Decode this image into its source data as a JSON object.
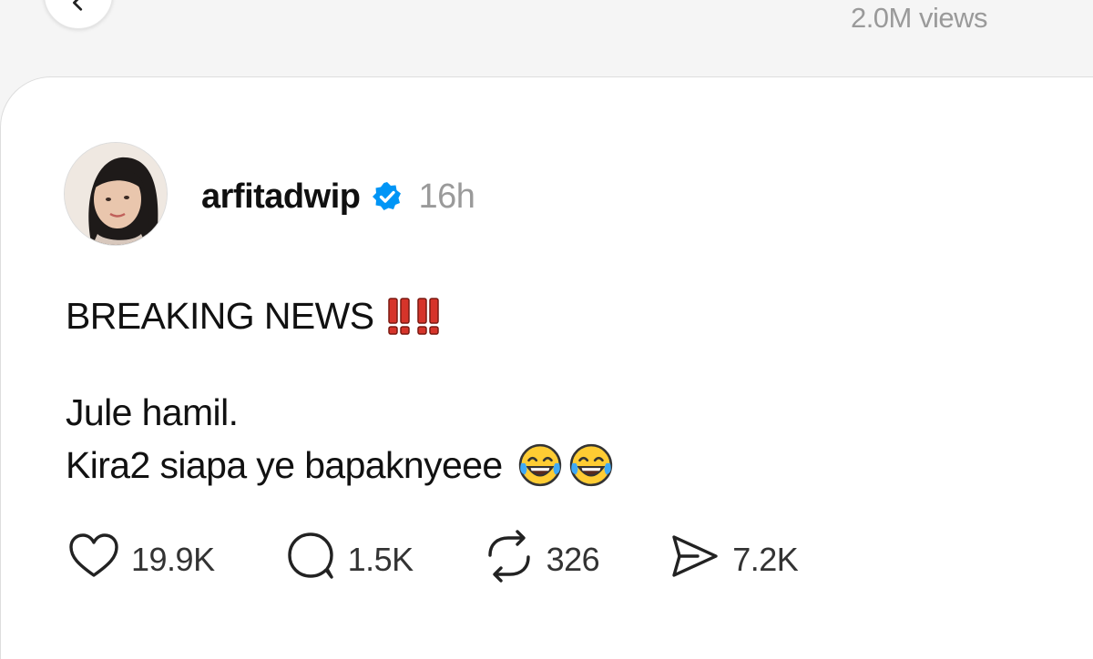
{
  "header": {
    "views": "2.0M views"
  },
  "post": {
    "username": "arfitadwip",
    "timestamp": "16h",
    "lines": {
      "headline": "BREAKING NEWS",
      "line1": "Jule hamil.",
      "line2": "Kira2 siapa ye bapaknyeee"
    },
    "emojis": {
      "headline": [
        "double-exclamation",
        "double-exclamation"
      ],
      "line2": [
        "tears-of-joy",
        "tears-of-joy"
      ]
    }
  },
  "actions": {
    "likes": "19.9K",
    "replies": "1.5K",
    "reposts": "326",
    "shares": "7.2K"
  },
  "icons": {
    "back": "chevron-left-icon",
    "verified": "verified-badge-icon",
    "like": "heart-icon",
    "reply": "comment-bubble-icon",
    "repost": "repost-icon",
    "share": "send-icon"
  },
  "colors": {
    "verified_blue": "#0095f6",
    "muted_text": "#9a9a9a",
    "emoji_red": "#d6342a",
    "emoji_yellow": "#ffcc33"
  }
}
